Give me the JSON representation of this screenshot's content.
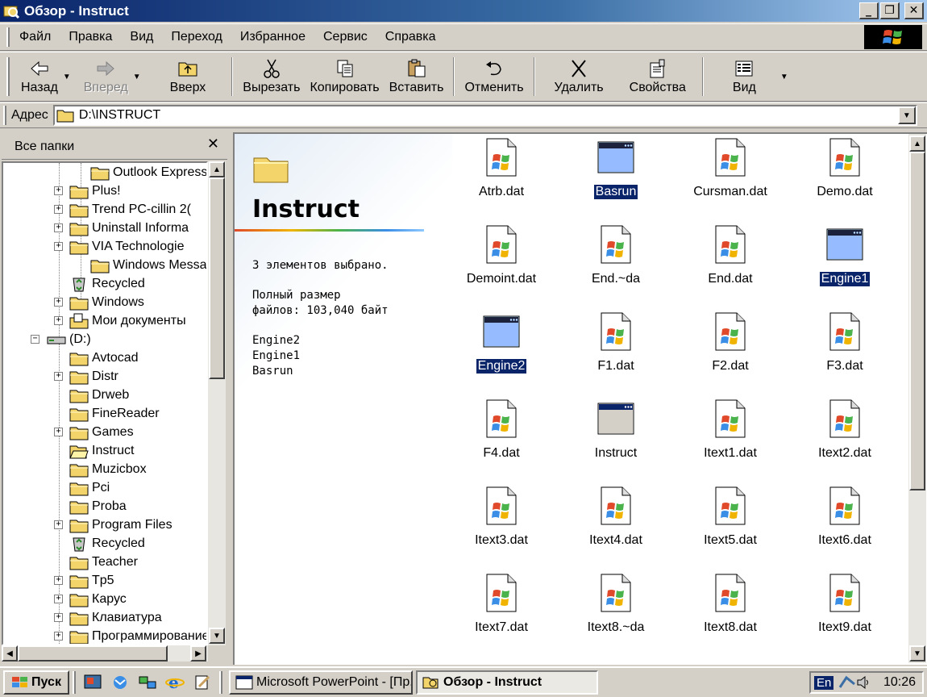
{
  "window": {
    "title": "Обзор - Instruct",
    "buttons": {
      "minimize": "_",
      "maximize": "❐",
      "close": "✕"
    }
  },
  "menu": [
    "Файл",
    "Правка",
    "Вид",
    "Переход",
    "Избранное",
    "Сервис",
    "Справка"
  ],
  "toolbar": {
    "back": "Назад",
    "forward": "Вперед",
    "up": "Вверх",
    "cut": "Вырезать",
    "copy": "Копировать",
    "paste": "Вставить",
    "undo": "Отменить",
    "delete": "Удалить",
    "properties": "Свойства",
    "view": "Вид"
  },
  "address": {
    "label": "Адрес",
    "value": "D:\\INSTRUCT"
  },
  "folders_pane": {
    "title": "Все папки",
    "close": "✕",
    "items": [
      {
        "label": "Outlook Express",
        "icon": "folder-icon",
        "expander": ""
      },
      {
        "label": "Plus!",
        "icon": "folder-icon",
        "expander": "+"
      },
      {
        "label": "Trend PC-cillin 2(",
        "icon": "folder-icon",
        "expander": "+"
      },
      {
        "label": "Uninstall Informa",
        "icon": "folder-icon",
        "expander": "+"
      },
      {
        "label": "VIA Technologie",
        "icon": "folder-icon",
        "expander": "+"
      },
      {
        "label": "Windows Messa",
        "icon": "folder-icon",
        "expander": ""
      },
      {
        "label": "Recycled",
        "icon": "recycle-bin-icon",
        "expander": ""
      },
      {
        "label": "Windows",
        "icon": "folder-icon",
        "expander": "+"
      },
      {
        "label": "Мои документы",
        "icon": "my-documents-icon",
        "expander": "+"
      },
      {
        "label": "(D:)",
        "icon": "drive-icon",
        "expander": "−"
      },
      {
        "label": "Avtocad",
        "icon": "folder-icon",
        "expander": ""
      },
      {
        "label": "Distr",
        "icon": "folder-icon",
        "expander": "+"
      },
      {
        "label": "Drweb",
        "icon": "folder-icon",
        "expander": ""
      },
      {
        "label": "FineReader",
        "icon": "folder-icon",
        "expander": ""
      },
      {
        "label": "Games",
        "icon": "folder-icon",
        "expander": "+"
      },
      {
        "label": "Instruct",
        "icon": "open-folder-icon",
        "expander": ""
      },
      {
        "label": "Muzicbox",
        "icon": "folder-icon",
        "expander": ""
      },
      {
        "label": "Pci",
        "icon": "folder-icon",
        "expander": ""
      },
      {
        "label": "Proba",
        "icon": "folder-icon",
        "expander": ""
      },
      {
        "label": "Program Files",
        "icon": "folder-icon",
        "expander": "+"
      },
      {
        "label": "Recycled",
        "icon": "recycle-bin-icon",
        "expander": ""
      },
      {
        "label": "Teacher",
        "icon": "folder-icon",
        "expander": ""
      },
      {
        "label": "Tp5",
        "icon": "folder-icon",
        "expander": "+"
      },
      {
        "label": "Карус",
        "icon": "folder-icon",
        "expander": "+"
      },
      {
        "label": "Клавиатура",
        "icon": "folder-icon",
        "expander": "+"
      },
      {
        "label": "Программирование",
        "icon": "folder-icon",
        "expander": "+"
      }
    ]
  },
  "webview": {
    "folder_name": "Instruct",
    "selection_line": "3 элементов выбрано.",
    "size_line1": "Полный размер",
    "size_line2": "файлов: 103,040 байт",
    "selected": [
      "Engine2",
      "Engine1",
      "Basrun"
    ]
  },
  "files": [
    {
      "name": "Atrb.dat",
      "icon": "dat-file-icon",
      "selected": false
    },
    {
      "name": "Basrun",
      "icon": "program-window-icon",
      "selected": true
    },
    {
      "name": "Cursman.dat",
      "icon": "dat-file-icon",
      "selected": false
    },
    {
      "name": "Demo.dat",
      "icon": "dat-file-icon",
      "selected": false
    },
    {
      "name": "Demoint.dat",
      "icon": "dat-file-icon",
      "selected": false
    },
    {
      "name": "End.~da",
      "icon": "dat-file-icon",
      "selected": false
    },
    {
      "name": "End.dat",
      "icon": "dat-file-icon",
      "selected": false
    },
    {
      "name": "Engine1",
      "icon": "program-window-icon",
      "selected": true
    },
    {
      "name": "Engine2",
      "icon": "program-window-icon",
      "selected": true
    },
    {
      "name": "F1.dat",
      "icon": "dat-file-icon",
      "selected": false
    },
    {
      "name": "F2.dat",
      "icon": "dat-file-icon",
      "selected": false
    },
    {
      "name": "F3.dat",
      "icon": "dat-file-icon",
      "selected": false
    },
    {
      "name": "F4.dat",
      "icon": "dat-file-icon",
      "selected": false
    },
    {
      "name": "Instruct",
      "icon": "program-window-icon",
      "selected": false
    },
    {
      "name": "Itext1.dat",
      "icon": "dat-file-icon",
      "selected": false
    },
    {
      "name": "Itext2.dat",
      "icon": "dat-file-icon",
      "selected": false
    },
    {
      "name": "Itext3.dat",
      "icon": "dat-file-icon",
      "selected": false
    },
    {
      "name": "Itext4.dat",
      "icon": "dat-file-icon",
      "selected": false
    },
    {
      "name": "Itext5.dat",
      "icon": "dat-file-icon",
      "selected": false
    },
    {
      "name": "Itext6.dat",
      "icon": "dat-file-icon",
      "selected": false
    },
    {
      "name": "Itext7.dat",
      "icon": "dat-file-icon",
      "selected": false
    },
    {
      "name": "Itext8.~da",
      "icon": "dat-file-icon",
      "selected": false
    },
    {
      "name": "Itext8.dat",
      "icon": "dat-file-icon",
      "selected": false
    },
    {
      "name": "Itext9.dat",
      "icon": "dat-file-icon",
      "selected": false
    }
  ],
  "taskbar": {
    "start": "Пуск",
    "tasks": [
      {
        "label": "Microsoft PowerPoint - [Пр...",
        "active": false
      },
      {
        "label": "Обзор - Instruct",
        "active": true
      }
    ],
    "lang": "En",
    "clock": "10:26"
  },
  "colors": {
    "title_start": "#0a246a",
    "title_end": "#a6caf0",
    "selection": "#0a246a",
    "face": "#d4d0c8"
  }
}
